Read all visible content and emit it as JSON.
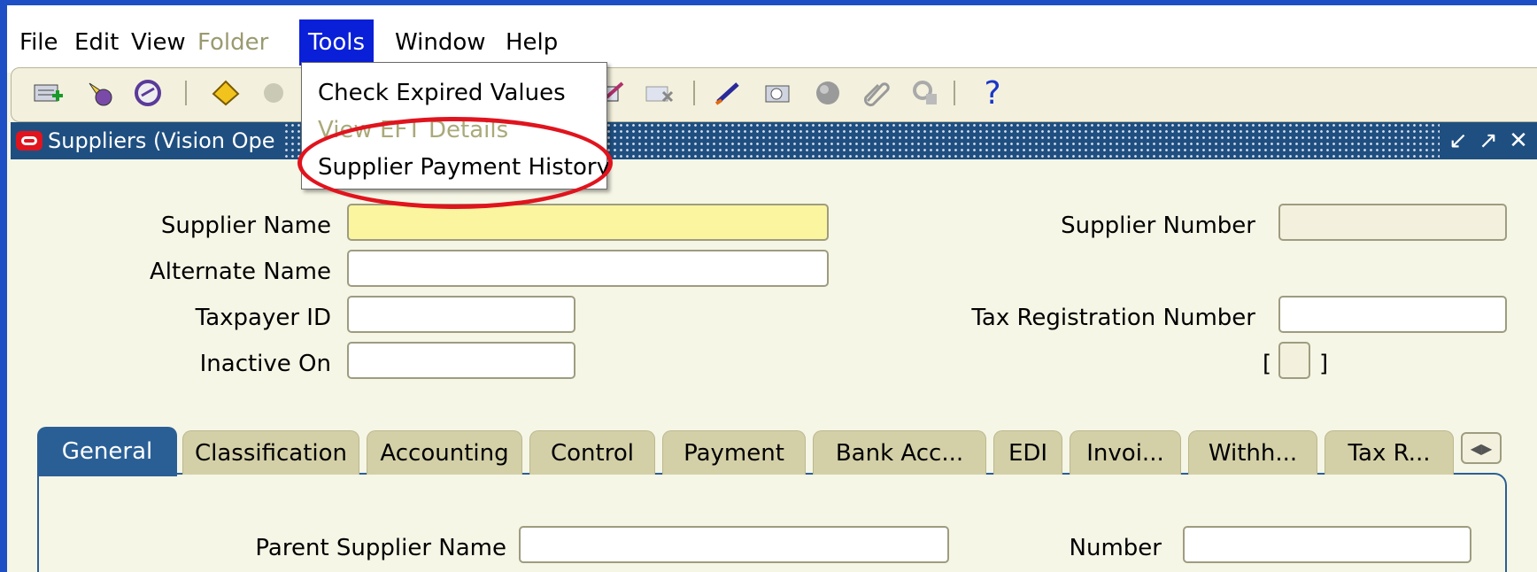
{
  "menu": {
    "file": "File",
    "edit": "Edit",
    "view": "View",
    "folder": "Folder",
    "tools": "Tools",
    "window": "Window",
    "help": "Help"
  },
  "toolbar": {
    "icons": [
      "new-record-icon",
      "find-icon",
      "navigator-icon",
      "save-icon",
      "next-step-icon",
      "attachments-icon",
      "edit-icon",
      "delete-icon",
      "spell-icon",
      "zoom-icon",
      "translations-icon",
      "clip-icon",
      "folder-tools-icon",
      "help-icon"
    ],
    "help_symbol": "?"
  },
  "window": {
    "title": "Suppliers (Vision Ope"
  },
  "tools_menu": {
    "items": [
      {
        "label": "Check Expired Values",
        "enabled": true
      },
      {
        "label": "View EFT Details",
        "enabled": false
      },
      {
        "label": "Supplier Payment History",
        "enabled": true
      }
    ]
  },
  "form": {
    "supplier_name_label": "Supplier Name",
    "alternate_name_label": "Alternate Name",
    "taxpayer_id_label": "Taxpayer ID",
    "inactive_on_label": "Inactive On",
    "supplier_number_label": "Supplier Number",
    "tax_registration_label": "Tax Registration Number",
    "bracket_open": "[",
    "bracket_close": "]"
  },
  "tabs": [
    "General",
    "Classification",
    "Accounting",
    "Control",
    "Payment",
    "Bank Acc...",
    "EDI",
    "Invoi...",
    "Withh...",
    "Tax R..."
  ],
  "general": {
    "parent_supplier_label": "Parent Supplier Name",
    "number_label": "Number"
  },
  "colors": {
    "menu_active": "#0a1fd8",
    "required_field": "#fbf5a0",
    "highlight_ring": "#e0141e",
    "active_tab": "#2a5f96"
  }
}
